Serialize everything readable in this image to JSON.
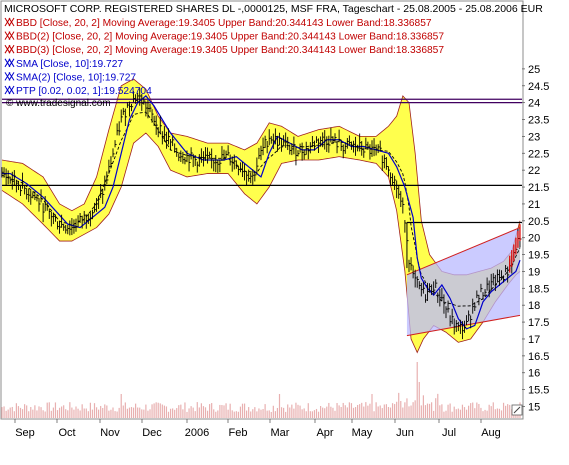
{
  "chart_data": {
    "type": "line",
    "title": "MICROSOFT CORP. REGISTERED SHARES DL -,0000125, MSF FRA, Tageschart - 25.08.2005 - 25.08.2006 EUR",
    "legend": [
      {
        "text": "BBD [Close, 20, 2] Moving Average:19.3405 Upper Band:20.344143 Lower Band:18.336857",
        "color": "#c00000"
      },
      {
        "text": "BBD(2) [Close, 20, 2] Moving Average:19.3405 Upper Band:20.344143 Lower Band:18.336857",
        "color": "#c00000"
      },
      {
        "text": "BBD(3) [Close, 20, 2] Moving Average:19.3405 Upper Band:20.344143 Lower Band:18.336857",
        "color": "#c00000"
      },
      {
        "text": "SMA [Close, 10]:19.727",
        "color": "#0000cc"
      },
      {
        "text": "SMA(2) [Close, 10]:19.727",
        "color": "#0000cc"
      },
      {
        "text": "PTP [0.02, 0.02, 1]:19.524704",
        "color": "#0000cc"
      }
    ],
    "legend_icon": "crossed-x-icon",
    "watermark": "© www.tradesignal.com",
    "x_tick_labels": [
      "Sep",
      "Oct",
      "Nov",
      "Dec",
      "2006",
      "Feb",
      "Mar",
      "Apr",
      "May",
      "Jun",
      "Jul",
      "Aug"
    ],
    "y_tick_labels": [
      "25",
      "24.5",
      "24",
      "23.5",
      "23",
      "22.5",
      "22",
      "21.5",
      "21",
      "20.5",
      "20",
      "19.5",
      "19",
      "18.5",
      "18",
      "17.5",
      "17",
      "16.5",
      "16",
      "15.5",
      "15"
    ],
    "ylim": [
      14.6,
      25.5
    ],
    "x_range": [
      0,
      252
    ],
    "horizontal_lines": [
      {
        "y": 24.1,
        "color": "#400060"
      },
      {
        "y": 24.0,
        "color": "#400060"
      },
      {
        "y": 21.55,
        "color": "#000000"
      },
      {
        "y": 20.45,
        "color": "#000000",
        "x_from": 197
      }
    ],
    "channel": {
      "x1": 197,
      "x2": 252,
      "upper": [
        18.9,
        20.3
      ],
      "lower": [
        17.1,
        17.7
      ],
      "fill": "#b9b9ff"
    },
    "price_keypoints": [
      [
        0,
        21.9
      ],
      [
        8,
        21.6
      ],
      [
        16,
        21.2
      ],
      [
        22,
        20.8
      ],
      [
        28,
        20.4
      ],
      [
        34,
        20.3
      ],
      [
        40,
        20.6
      ],
      [
        46,
        20.9
      ],
      [
        50,
        21.5
      ],
      [
        54,
        22.5
      ],
      [
        58,
        23.5
      ],
      [
        62,
        24.0
      ],
      [
        66,
        24.2
      ],
      [
        70,
        23.9
      ],
      [
        74,
        23.5
      ],
      [
        78,
        23.1
      ],
      [
        82,
        22.8
      ],
      [
        86,
        22.5
      ],
      [
        90,
        22.4
      ],
      [
        94,
        22.3
      ],
      [
        98,
        22.3
      ],
      [
        104,
        22.3
      ],
      [
        110,
        22.4
      ],
      [
        114,
        22.2
      ],
      [
        118,
        22.0
      ],
      [
        122,
        21.8
      ],
      [
        126,
        22.5
      ],
      [
        130,
        23.0
      ],
      [
        136,
        22.8
      ],
      [
        142,
        22.6
      ],
      [
        148,
        22.6
      ],
      [
        154,
        22.9
      ],
      [
        160,
        22.9
      ],
      [
        166,
        22.7
      ],
      [
        172,
        22.7
      ],
      [
        178,
        22.6
      ],
      [
        184,
        22.5
      ],
      [
        188,
        22.1
      ],
      [
        192,
        21.5
      ],
      [
        196,
        20.6
      ],
      [
        198,
        19.4
      ],
      [
        200,
        18.8
      ],
      [
        203,
        18.5
      ],
      [
        206,
        18.3
      ],
      [
        210,
        18.6
      ],
      [
        214,
        18.2
      ],
      [
        218,
        17.6
      ],
      [
        222,
        17.3
      ],
      [
        226,
        17.4
      ],
      [
        230,
        18.1
      ],
      [
        234,
        18.4
      ],
      [
        238,
        18.6
      ],
      [
        242,
        18.8
      ],
      [
        246,
        19.0
      ],
      [
        249,
        19.5
      ],
      [
        252,
        20.1
      ]
    ],
    "upper_band_keypoints": [
      [
        0,
        22.3
      ],
      [
        10,
        22.2
      ],
      [
        20,
        21.8
      ],
      [
        28,
        21.0
      ],
      [
        34,
        20.8
      ],
      [
        40,
        21.0
      ],
      [
        46,
        21.8
      ],
      [
        52,
        23.2
      ],
      [
        58,
        24.5
      ],
      [
        64,
        24.7
      ],
      [
        70,
        24.4
      ],
      [
        76,
        23.6
      ],
      [
        82,
        23.1
      ],
      [
        90,
        23.0
      ],
      [
        100,
        22.8
      ],
      [
        110,
        22.8
      ],
      [
        118,
        22.6
      ],
      [
        124,
        22.8
      ],
      [
        130,
        23.4
      ],
      [
        136,
        23.3
      ],
      [
        144,
        23.0
      ],
      [
        154,
        23.2
      ],
      [
        164,
        23.3
      ],
      [
        174,
        23.0
      ],
      [
        182,
        23.0
      ],
      [
        188,
        23.3
      ],
      [
        192,
        23.6
      ],
      [
        195,
        24.2
      ],
      [
        198,
        24.0
      ],
      [
        201,
        22.5
      ],
      [
        204,
        20.5
      ],
      [
        208,
        19.5
      ],
      [
        214,
        19.0
      ],
      [
        220,
        18.9
      ],
      [
        226,
        18.9
      ],
      [
        232,
        19.0
      ],
      [
        238,
        19.1
      ],
      [
        244,
        19.3
      ],
      [
        248,
        19.6
      ],
      [
        252,
        20.5
      ]
    ],
    "lower_band_keypoints": [
      [
        0,
        21.4
      ],
      [
        10,
        21.0
      ],
      [
        20,
        20.4
      ],
      [
        28,
        19.9
      ],
      [
        34,
        19.9
      ],
      [
        40,
        20.1
      ],
      [
        46,
        20.3
      ],
      [
        52,
        20.7
      ],
      [
        58,
        21.5
      ],
      [
        64,
        22.8
      ],
      [
        70,
        23.1
      ],
      [
        76,
        22.7
      ],
      [
        82,
        22.0
      ],
      [
        90,
        21.8
      ],
      [
        100,
        21.9
      ],
      [
        110,
        21.9
      ],
      [
        118,
        21.3
      ],
      [
        124,
        21.0
      ],
      [
        130,
        21.5
      ],
      [
        136,
        22.2
      ],
      [
        144,
        22.3
      ],
      [
        154,
        22.3
      ],
      [
        164,
        22.4
      ],
      [
        174,
        22.3
      ],
      [
        182,
        22.2
      ],
      [
        188,
        21.8
      ],
      [
        192,
        20.8
      ],
      [
        196,
        19.0
      ],
      [
        199,
        17.0
      ],
      [
        202,
        16.6
      ],
      [
        205,
        17.0
      ],
      [
        210,
        17.4
      ],
      [
        216,
        17.2
      ],
      [
        222,
        16.9
      ],
      [
        228,
        17.0
      ],
      [
        234,
        17.5
      ],
      [
        240,
        18.1
      ],
      [
        246,
        18.6
      ],
      [
        250,
        18.9
      ],
      [
        252,
        19.0
      ]
    ],
    "colors": {
      "price": "#000000",
      "band_fill": "#ffff4d",
      "band_line": "#a02020",
      "sma": "#0000cc",
      "band_mid": "#000000",
      "volume": "#e8b0b0",
      "border": "#8c8c8c"
    }
  }
}
